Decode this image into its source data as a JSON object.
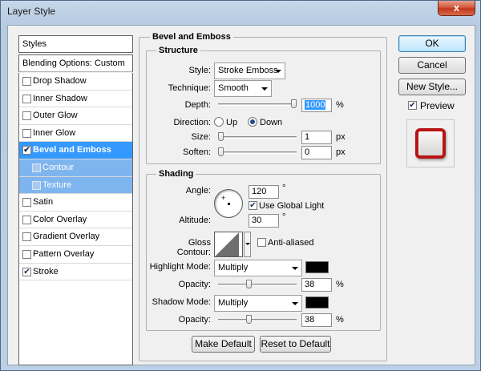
{
  "window": {
    "title": "Layer Style",
    "close_glyph": "x"
  },
  "styles_list": {
    "header": "Styles",
    "blending": "Blending Options: Custom",
    "items": [
      {
        "label": "Drop Shadow",
        "checked": false
      },
      {
        "label": "Inner Shadow",
        "checked": false
      },
      {
        "label": "Outer Glow",
        "checked": false
      },
      {
        "label": "Inner Glow",
        "checked": false
      },
      {
        "label": "Bevel and Emboss",
        "checked": true
      },
      {
        "label": "Contour",
        "checked": false
      },
      {
        "label": "Texture",
        "checked": false
      },
      {
        "label": "Satin",
        "checked": false
      },
      {
        "label": "Color Overlay",
        "checked": false
      },
      {
        "label": "Gradient Overlay",
        "checked": false
      },
      {
        "label": "Pattern Overlay",
        "checked": false
      },
      {
        "label": "Stroke",
        "checked": true
      }
    ]
  },
  "panel": {
    "title": "Bevel and Emboss",
    "structure": {
      "label": "Structure",
      "style_label": "Style:",
      "style_value": "Stroke Emboss",
      "technique_label": "Technique:",
      "technique_value": "Smooth",
      "depth_label": "Depth:",
      "depth_value": "1000",
      "depth_unit": "%",
      "depth_level": 1.0,
      "direction_label": "Direction:",
      "direction_up": "Up",
      "direction_down": "Down",
      "size_label": "Size:",
      "size_value": "1",
      "size_unit": "px",
      "size_level": 0.0,
      "soften_label": "Soften:",
      "soften_value": "0",
      "soften_unit": "px",
      "soften_level": 0.0
    },
    "shading": {
      "label": "Shading",
      "angle_label": "Angle:",
      "angle_value": "120",
      "angle_unit": "°",
      "global_light": "Use Global Light",
      "altitude_label": "Altitude:",
      "altitude_value": "30",
      "altitude_unit": "°",
      "gloss_label": "Gloss Contour:",
      "anti_aliased": "Anti-aliased",
      "highlight_label": "Highlight Mode:",
      "highlight_value": "Multiply",
      "highlight_color": "#000000",
      "opacity1_label": "Opacity:",
      "opacity1_value": "38",
      "opacity1_unit": "%",
      "opacity1_level": 0.38,
      "shadow_label": "Shadow Mode:",
      "shadow_value": "Multiply",
      "shadow_color": "#000000",
      "opacity2_label": "Opacity:",
      "opacity2_value": "38",
      "opacity2_unit": "%",
      "opacity2_level": 0.38
    },
    "make_default": "Make Default",
    "reset_default": "Reset to Default"
  },
  "buttons": {
    "ok": "OK",
    "cancel": "Cancel",
    "new_style": "New Style...",
    "preview": "Preview"
  },
  "colors": {
    "accent": "#3399ff",
    "stroke_red": "#b81414"
  }
}
